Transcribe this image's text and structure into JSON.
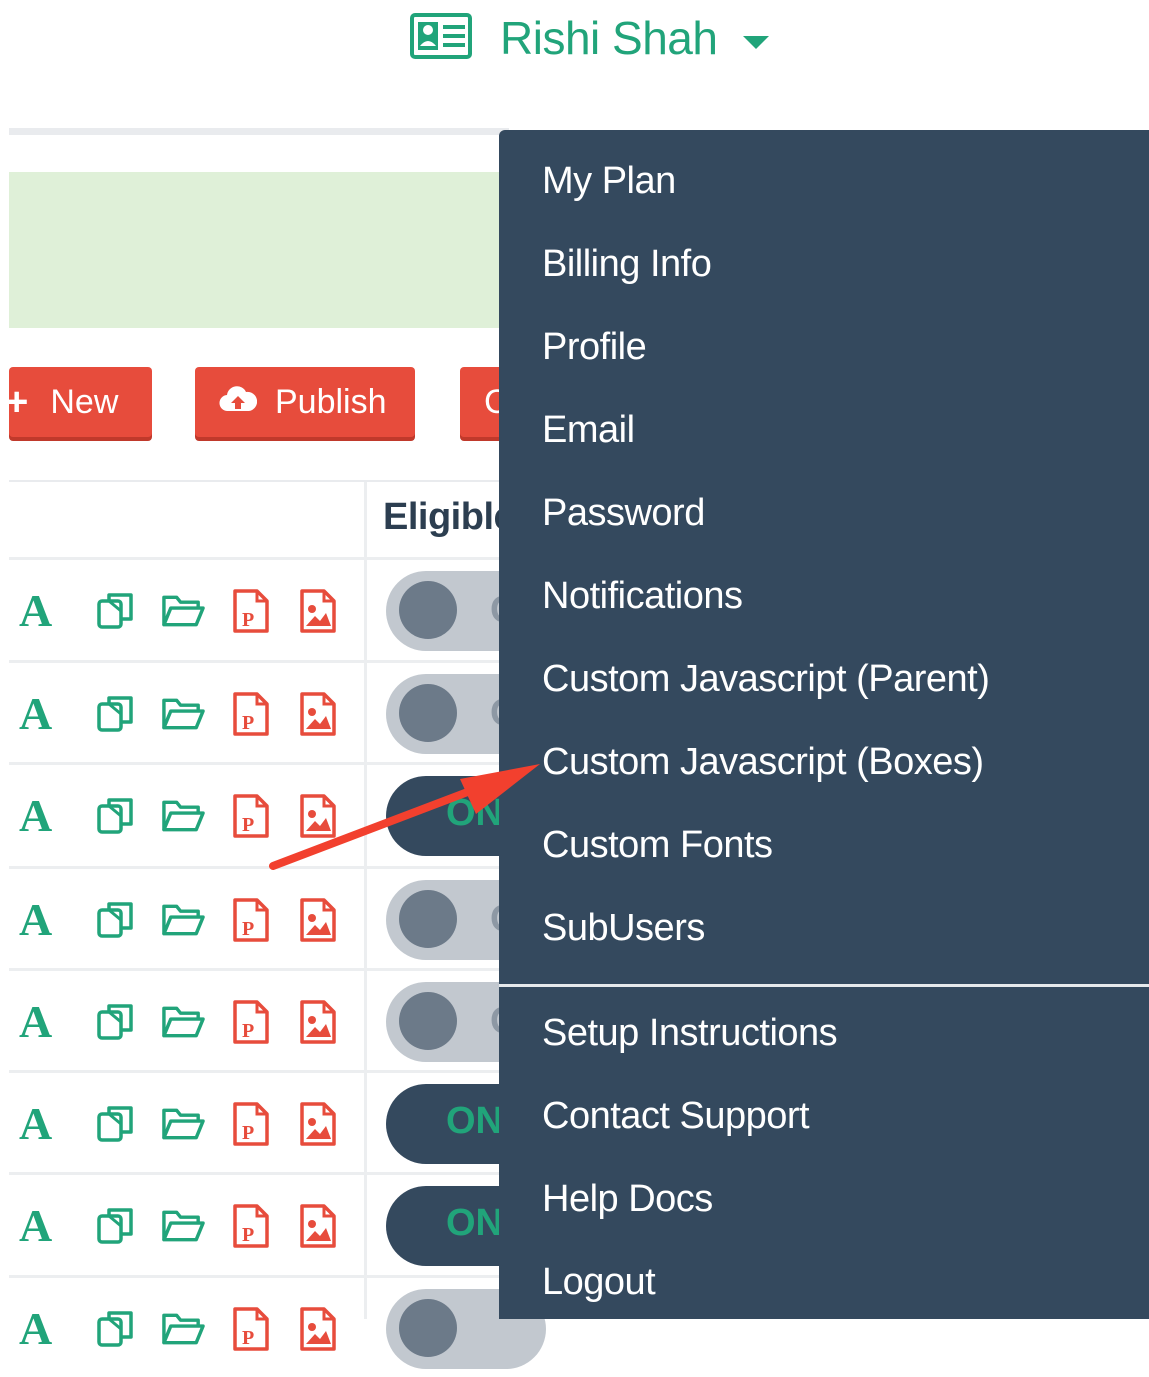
{
  "user_menu": {
    "name": "Rishi Shah"
  },
  "toolbar": {
    "new_label": "New",
    "publish_label": "Publish",
    "third_label": "C"
  },
  "table": {
    "headers": {
      "eligible": "Eligible"
    },
    "rows": [
      {
        "toggle": "off",
        "toggle_label": "O"
      },
      {
        "toggle": "off",
        "toggle_label": "O"
      },
      {
        "toggle": "on",
        "toggle_label": "ON"
      },
      {
        "toggle": "off",
        "toggle_label": "O"
      },
      {
        "toggle": "off",
        "toggle_label": "O"
      },
      {
        "toggle": "on",
        "toggle_label": "ON"
      },
      {
        "toggle": "on",
        "toggle_label": "ON"
      },
      {
        "toggle": "off",
        "toggle_label": ""
      }
    ],
    "icon_letter": "A"
  },
  "dropdown": {
    "items": [
      "My Plan",
      "Billing Info",
      "Profile",
      "Email",
      "Password",
      "Notifications",
      "Custom Javascript (Parent)",
      "Custom Javascript (Boxes)",
      "Custom Fonts",
      "SubUsers",
      "Setup Instructions",
      "Contact Support",
      "Help Docs",
      "Logout"
    ]
  },
  "colors": {
    "accent_green": "#21a47a",
    "danger_red": "#e74c3c",
    "dropdown_bg": "#34495e",
    "annotation_arrow": "#f2402e"
  }
}
